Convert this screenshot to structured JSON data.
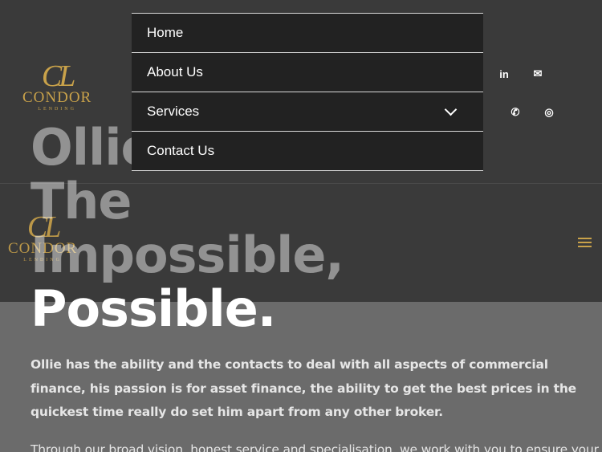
{
  "brand": {
    "monogram": "CL",
    "name": "CONDOR",
    "tagline": "LENDING",
    "gold": "#c9a24a"
  },
  "nav": {
    "items": [
      {
        "label": "Home"
      },
      {
        "label": "About Us"
      },
      {
        "label": "Services",
        "has_submenu": true
      },
      {
        "label": "Contact Us"
      }
    ]
  },
  "social": {
    "icons": [
      "linkedin-icon",
      "mail-icon",
      "phone-icon",
      "instagram-icon"
    ],
    "linkedin_glyph": "in",
    "mail_glyph": "✉",
    "phone_glyph": "✆",
    "instagram_glyph": "◎"
  },
  "hero": {
    "title_line1": "Ollie Makes",
    "title_line2": "The",
    "title_line3": "Impossible,",
    "title_line4": "Possible.",
    "paragraph": "Ollie has the ability and the contacts to deal with all aspects of commercial finance, his passion is for asset finance, the ability to get the best prices in the quickest time really do set him apart from any other broker.",
    "paragraph2": "Through our broad vision, honest service and specialisation, we work with you to ensure your"
  },
  "colors": {
    "header_bg": "#3a3a3a",
    "menu_bg": "#222222",
    "body_bg": "#6b6b6b",
    "accent_gold": "#c9a24a"
  }
}
